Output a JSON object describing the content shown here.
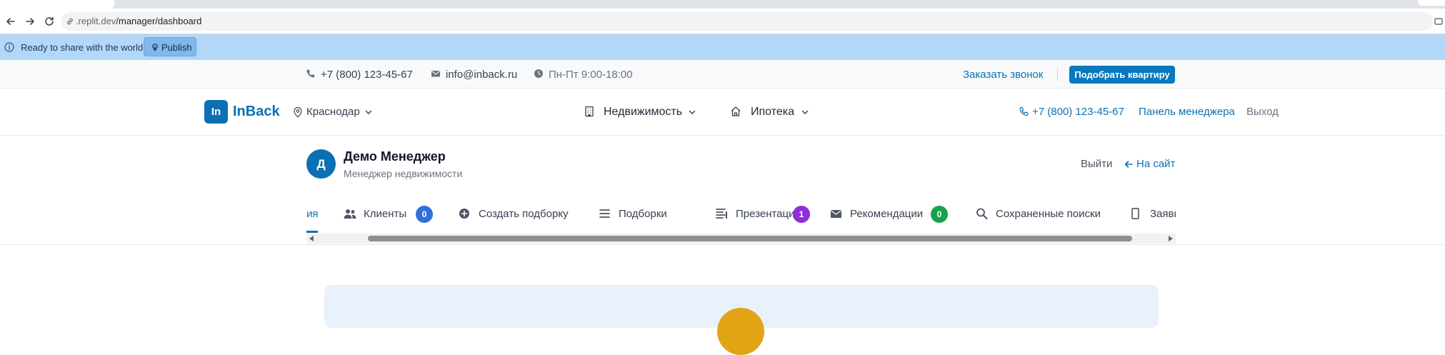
{
  "browser": {
    "url_host": ".replit.dev",
    "url_path": "/manager/dashboard"
  },
  "banner": {
    "message": "Ready to share with the world?",
    "publish_label": "Publish"
  },
  "topbar": {
    "phone": "+7 (800) 123-45-67",
    "email": "info@inback.ru",
    "hours": "Пн-Пт 9:00-18:00",
    "callback": "Заказать звонок",
    "pick_apartment": "Подобрать квартиру"
  },
  "header": {
    "logo_mark": "In",
    "logo_text": "InBack",
    "city": "Краснодар",
    "menu": [
      {
        "label": "Недвижимость",
        "icon": "building-icon"
      },
      {
        "label": "Ипотека",
        "icon": "home-icon"
      }
    ],
    "phone": "+7 (800) 123-45-67",
    "manager_panel": "Панель менеджера",
    "exit": "Выход"
  },
  "profile": {
    "initial": "Д",
    "name": "Демо Менеджер",
    "role": "Менеджер недвижимости",
    "logout": "Выйти",
    "back_to_site": "На сайт"
  },
  "tabs": {
    "partial_first": "ия",
    "items": [
      {
        "label": "Клиенты",
        "icon": "users-icon",
        "badge": "0",
        "badge_color": "#2f6fdc"
      },
      {
        "label": "Создать подборку",
        "icon": "plus-circle-icon"
      },
      {
        "label": "Подборки",
        "icon": "list-icon"
      },
      {
        "label": "Презентации",
        "icon": "presentation-icon",
        "badge": "1",
        "badge_color": "#8b2fd9"
      },
      {
        "label": "Рекомендации",
        "icon": "envelope-icon",
        "badge": "0",
        "badge_color": "#16a34a"
      },
      {
        "label": "Сохраненные поиски",
        "icon": "search-icon"
      },
      {
        "label": "Заявки",
        "icon": "mobile-icon"
      }
    ]
  },
  "colors": {
    "brand": "#0a70b3",
    "banner": "#b3d7f8",
    "hero_bg": "#e8f1fc",
    "hero_circle": "#e0a415"
  }
}
